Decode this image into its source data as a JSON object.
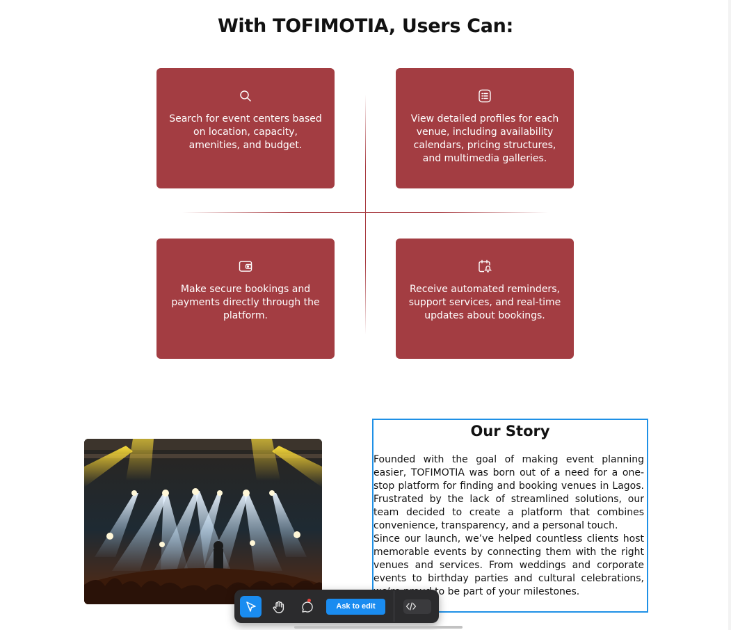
{
  "heading": "With TOFIMOTIA, Users Can:",
  "features": [
    {
      "icon": "search-icon",
      "text": "Search for event centers based on location, capacity, amenities, and budget."
    },
    {
      "icon": "list-details-icon",
      "text": "View detailed profiles for each venue, including availability calendars, pricing structures, and multimedia galleries."
    },
    {
      "icon": "wallet-icon",
      "text": "Make secure bookings and payments directly through the platform."
    },
    {
      "icon": "calendar-bell-icon",
      "text": "Receive automated reminders, support services, and real-time updates about bookings."
    }
  ],
  "story": {
    "title": "Our Story",
    "paragraphs": [
      "Founded with the goal of making event planning easier, TOFIMOTIA was born out of a need for a one-stop platform for finding and booking venues in Lagos. Frustrated by the lack of streamlined solutions, our team decided to create a platform that combines convenience, transparency, and a personal touch.",
      "Since our launch, we’ve helped countless clients host memorable events by connecting them with the right venues and services. From weddings and corporate events to birthday parties and cultural celebrations, we’re proud to be part of your milestones."
    ]
  },
  "toolbar": {
    "ask_label": "Ask to edit",
    "tools": [
      "select-tool-icon",
      "hand-tool-icon",
      "comment-tool-icon",
      "code-view-icon"
    ]
  },
  "colors": {
    "card_bg": "#a33d42",
    "accent_blue": "#1a8cf0",
    "toolbar_bg": "#2b2b2d"
  }
}
